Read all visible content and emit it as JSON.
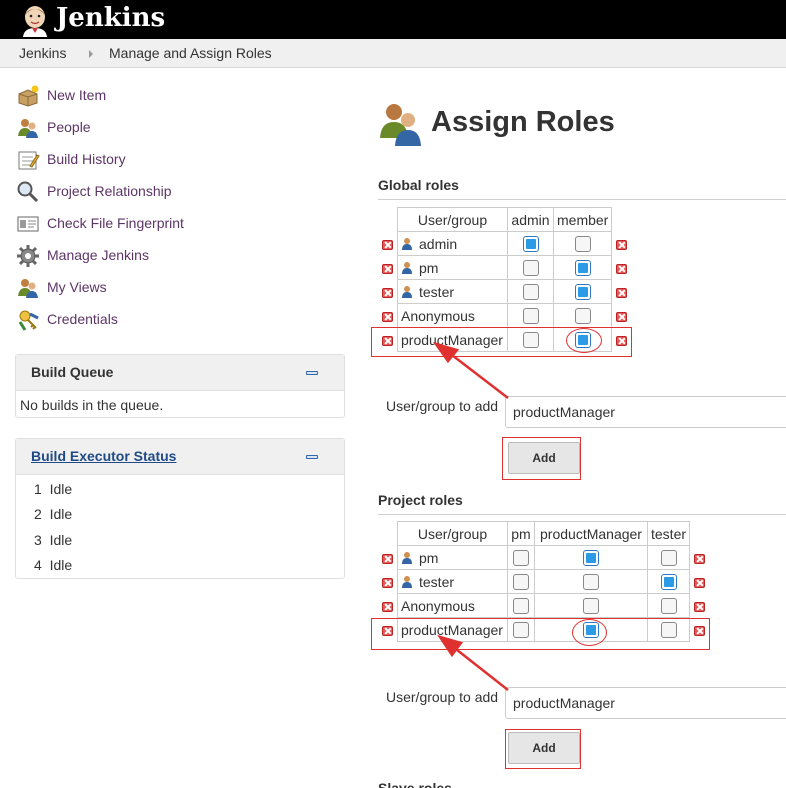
{
  "app": {
    "title": "Jenkins",
    "logo_icon": "jenkins-butler-icon"
  },
  "breadcrumb": [
    "Jenkins",
    "Manage and Assign Roles"
  ],
  "sidebar": {
    "tasks": [
      {
        "label": "New Item",
        "icon": "new-item-icon"
      },
      {
        "label": "People",
        "icon": "people-icon"
      },
      {
        "label": "Build History",
        "icon": "build-history-icon"
      },
      {
        "label": "Project Relationship",
        "icon": "magnifier-icon"
      },
      {
        "label": "Check File Fingerprint",
        "icon": "fingerprint-icon"
      },
      {
        "label": "Manage Jenkins",
        "icon": "gear-icon"
      },
      {
        "label": "My Views",
        "icon": "my-views-icon"
      },
      {
        "label": "Credentials",
        "icon": "credentials-icon"
      }
    ],
    "build_queue": {
      "title": "Build Queue",
      "empty_text": "No builds in the queue."
    },
    "executor_status": {
      "title": "Build Executor Status",
      "executors": [
        {
          "number": "1",
          "status": "Idle"
        },
        {
          "number": "2",
          "status": "Idle"
        },
        {
          "number": "3",
          "status": "Idle"
        },
        {
          "number": "4",
          "status": "Idle"
        }
      ]
    }
  },
  "main": {
    "title": "Assign Roles",
    "global": {
      "heading": "Global roles",
      "columns": [
        "User/group",
        "admin",
        "member"
      ],
      "rows": [
        {
          "name": "admin",
          "user_icon": true,
          "checks": [
            true,
            false
          ]
        },
        {
          "name": "pm",
          "user_icon": true,
          "checks": [
            false,
            true
          ]
        },
        {
          "name": "tester",
          "user_icon": true,
          "checks": [
            false,
            true
          ]
        },
        {
          "name": "Anonymous",
          "user_icon": false,
          "checks": [
            false,
            false
          ]
        },
        {
          "name": "productManager",
          "user_icon": false,
          "checks": [
            false,
            true
          ]
        }
      ],
      "add_label": "User/group to add",
      "add_value": "productManager",
      "add_button": "Add"
    },
    "project": {
      "heading": "Project roles",
      "columns": [
        "User/group",
        "pm",
        "productManager",
        "tester"
      ],
      "rows": [
        {
          "name": "pm",
          "user_icon": true,
          "checks": [
            false,
            true,
            false
          ]
        },
        {
          "name": "tester",
          "user_icon": true,
          "checks": [
            false,
            false,
            true
          ]
        },
        {
          "name": "Anonymous",
          "user_icon": false,
          "checks": [
            false,
            false,
            false
          ]
        },
        {
          "name": "productManager",
          "user_icon": false,
          "checks": [
            false,
            true,
            false
          ]
        }
      ],
      "add_label": "User/group to add",
      "add_value": "productManager",
      "add_button": "Add"
    },
    "next_heading": "Slave roles"
  },
  "colors": {
    "accent": "#2b9be5",
    "link": "#5c3566",
    "annotation": "#e03131"
  }
}
